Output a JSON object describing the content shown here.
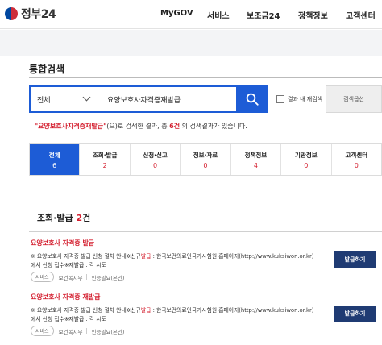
{
  "header": {
    "logo_text": "정부24",
    "nav": [
      "MyGOV",
      "서비스",
      "보조금24",
      "정책정보",
      "고객센터"
    ]
  },
  "page_title": "통합검색",
  "search": {
    "scope": "전체",
    "query": "요양보호사자격증재발급",
    "within_label": "결과 내 재검색",
    "options_label": "검색옵션"
  },
  "result_message": {
    "keyword": "\"요양보호사자격증재발급\"",
    "text1": "(으)로 검색한 결과, 총 ",
    "total": "6건",
    "text2": " 의 검색결과가 있습니다."
  },
  "tabs": [
    {
      "name": "전체",
      "count": "6"
    },
    {
      "name": "조회·발급",
      "count": "2"
    },
    {
      "name": "신청·신고",
      "count": "0"
    },
    {
      "name": "정보·자료",
      "count": "0"
    },
    {
      "name": "정책정보",
      "count": "4"
    },
    {
      "name": "기관정보",
      "count": "0"
    },
    {
      "name": "고객센터",
      "count": "0"
    }
  ],
  "section": {
    "title": "조회·발급",
    "count": "2",
    "unit": "건"
  },
  "items": [
    {
      "title": "요양보호사 자격증 발급",
      "desc_pre": "※ 요양보호사 자격증 발급 신청 절차 안내※신규",
      "desc_hl": "발급",
      "desc_post": " : 한국보건의료인국가시험원 홈페이지(http://www.kuksiwon.or.kr) 에서 신청 접수※재발급 : 각 시도",
      "badge": "서비스",
      "dept": "보건복지부",
      "auth": "인증필요(본인)",
      "button": "발급하기"
    },
    {
      "title": "요양보호사 자격증 재발급",
      "desc_pre": "※ 요양보호사 자격증 발급 신청 절차 안내※신규",
      "desc_hl": "발급",
      "desc_post": " : 한국보건의료인국가시험원 홈페이지(http://www.kuksiwon.or.kr) 에서 신청 접수※재발급 : 각 시도",
      "badge": "서비스",
      "dept": "보건복지부",
      "auth": "인증필요(본인)",
      "button": "발급하기"
    }
  ],
  "colors": {
    "primary_blue": "#1d5cd6",
    "highlight_red": "#d41f2f",
    "navy_button": "#1f3b73"
  }
}
